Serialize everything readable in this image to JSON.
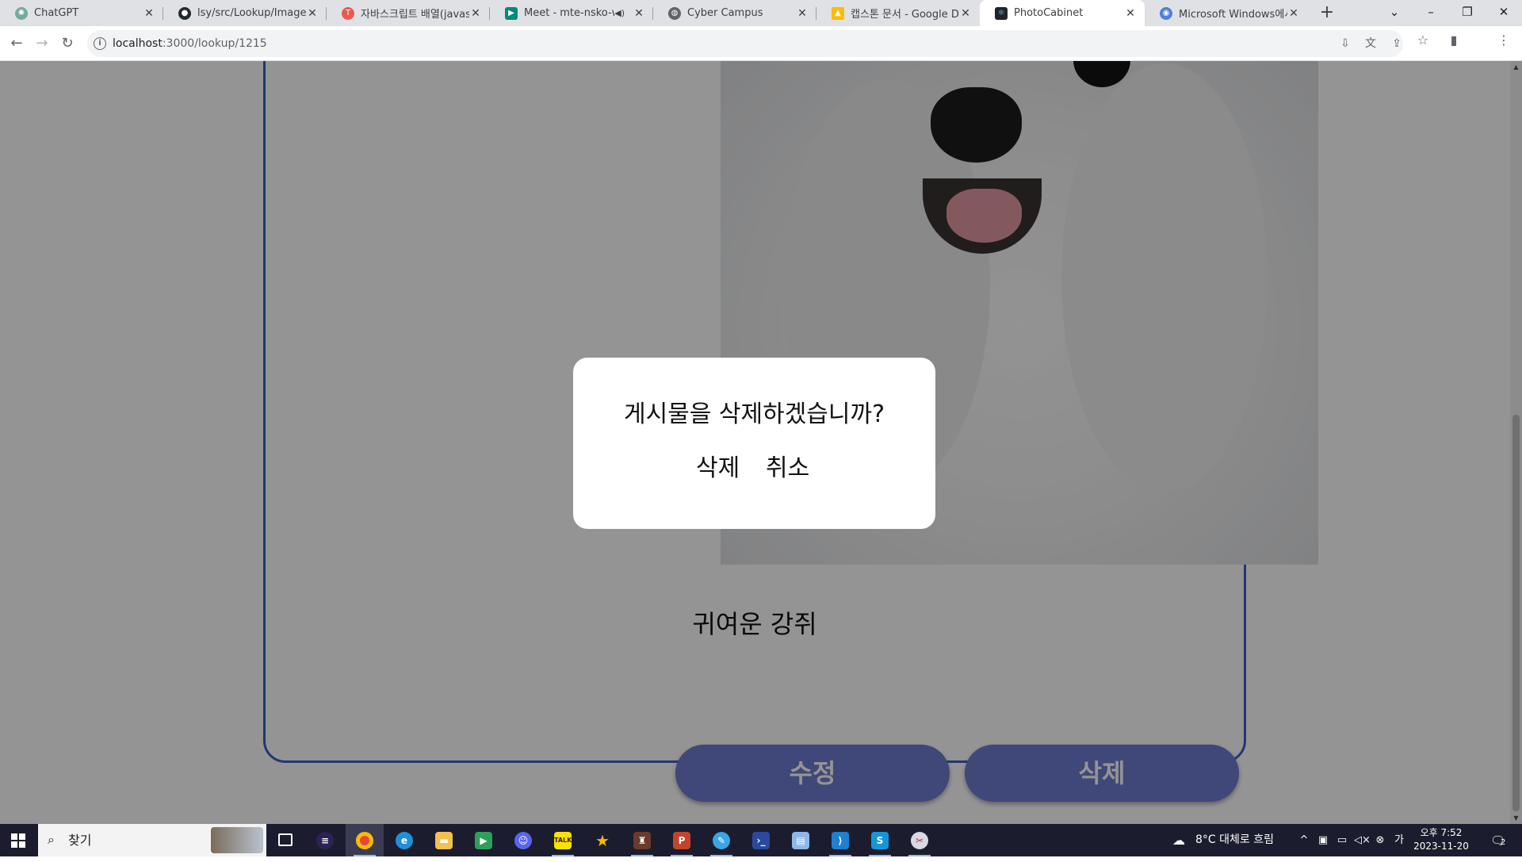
{
  "browser": {
    "tabs": [
      {
        "title": "ChatGPT",
        "icon": "chatgpt-icon",
        "color": "#74aa9c"
      },
      {
        "title": "lsy/src/Lookup/Image_Lo",
        "icon": "github-icon",
        "color": "#24292f"
      },
      {
        "title": "자바스크립트 배열(javasc",
        "icon": "tistory-icon",
        "color": "#eb5a4f"
      },
      {
        "title": "Meet - mte-nsko-wp",
        "icon": "google-meet-icon",
        "color": "#00897b"
      },
      {
        "title": "Cyber Campus",
        "icon": "globe-icon",
        "color": "#5f6368"
      },
      {
        "title": "캡스톤 문서 - Google Dri",
        "icon": "google-drive-icon",
        "color": "#fbbc04"
      },
      {
        "title": "PhotoCabinet",
        "icon": "react-icon",
        "color": "#20232a"
      },
      {
        "title": "Microsoft Windows에서",
        "icon": "site-icon",
        "color": "#4f7fd6"
      }
    ],
    "active_tab": "PhotoCabinet",
    "url_host": "localhost",
    "url_path": ":3000/lookup/1215"
  },
  "page": {
    "caption": "귀여운 강쥐",
    "edit_button": "수정",
    "delete_button": "삭제",
    "accent_color": "#3a5ec8",
    "button_color": "#6f7ad0"
  },
  "dialog": {
    "message": "게시물을 삭제하겠습니까?",
    "confirm": "삭제",
    "cancel": "취소"
  },
  "taskbar": {
    "search_placeholder": "찾기",
    "weather": "8°C  대체로 흐림",
    "time": "오후 7:52",
    "date": "2023-11-20",
    "notification_count": "2"
  }
}
